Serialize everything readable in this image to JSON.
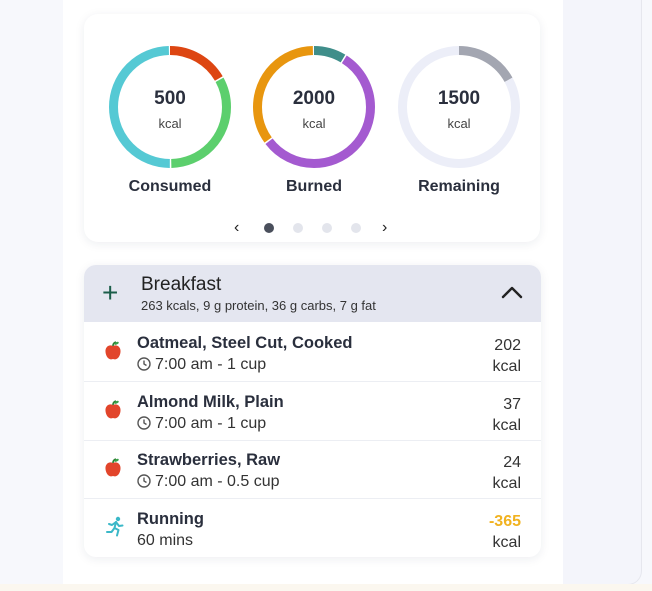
{
  "summary": {
    "rings": [
      {
        "value": "500",
        "unit": "kcal",
        "label": "Consumed",
        "segments": [
          {
            "fraction": 0.17,
            "color": "#dd4612"
          },
          {
            "fraction": 0.33,
            "color": "#5ccf6d"
          },
          {
            "fraction": 0.5,
            "color": "#55c9d4"
          }
        ]
      },
      {
        "value": "2000",
        "unit": "kcal",
        "label": "Burned",
        "segments": [
          {
            "fraction": 0.09,
            "color": "#3f8e8a"
          },
          {
            "fraction": 0.56,
            "color": "#a45ad0"
          },
          {
            "fraction": 0.35,
            "color": "#e8960f"
          }
        ]
      },
      {
        "value": "1500",
        "unit": "kcal",
        "label": "Remaining",
        "segments": [
          {
            "fraction": 0.17,
            "color": "#a3a6b1"
          },
          {
            "fraction": 0.83,
            "color": "#eceef8"
          }
        ]
      }
    ],
    "pager": {
      "prev": "‹",
      "next": "›",
      "pages": 4,
      "active": 0
    }
  },
  "meal": {
    "title": "Breakfast",
    "summary": "263 kcals, 9 g protein, 36 g carbs, 7 g fat",
    "add_icon": "plus-icon",
    "collapse_icon": "chevron-up-icon",
    "items": [
      {
        "name": "Oatmeal, Steel Cut, Cooked",
        "meta": "7:00 am - 1 cup",
        "value": "202",
        "unit": "kcal",
        "icon": "apple-icon"
      },
      {
        "name": "Almond Milk, Plain",
        "meta": "7:00 am - 1 cup",
        "value": "37",
        "unit": "kcal",
        "icon": "apple-icon"
      },
      {
        "name": "Strawberries, Raw",
        "meta": "7:00 am - 0.5 cup",
        "value": "24",
        "unit": "kcal",
        "icon": "apple-icon"
      },
      {
        "name": "Running",
        "meta": "60 mins",
        "value": "-365",
        "unit": "kcal",
        "icon": "running-icon"
      }
    ]
  }
}
